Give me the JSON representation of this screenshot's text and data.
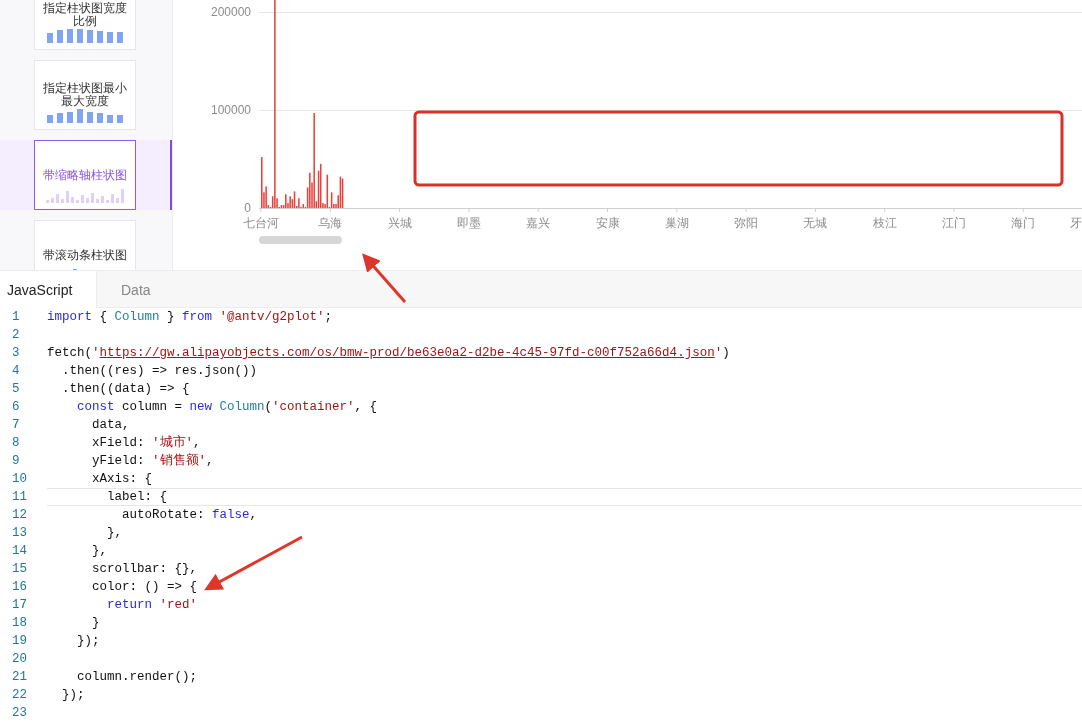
{
  "sidebar": {
    "items": [
      {
        "label": "指定柱状图宽度比例",
        "selected": false,
        "kind": "even"
      },
      {
        "label": "指定柱状图最小最大宽度",
        "selected": false,
        "kind": "peak"
      },
      {
        "label": "带缩略轴柱状图",
        "selected": true,
        "kind": "dense"
      },
      {
        "label": "带滚动条柱状图",
        "selected": false,
        "kind": "spike"
      }
    ]
  },
  "chart": {
    "y_ticks": [
      "200000",
      "100000",
      "0"
    ],
    "x_labels": [
      "七台河",
      "乌海",
      "兴城",
      "即墨",
      "嘉兴",
      "安康",
      "巢湖",
      "弥阳",
      "无城",
      "枝江",
      "江门",
      "海门",
      "牙"
    ]
  },
  "editor": {
    "tabs": [
      {
        "label": "JavaScript",
        "selected": true
      },
      {
        "label": "Data",
        "selected": false
      }
    ],
    "lines": [
      {
        "number": "1",
        "current": false,
        "tokens": [
          {
            "kind": "keyword",
            "text": "import"
          },
          {
            "kind": "plain",
            "text": " { "
          },
          {
            "kind": "type",
            "text": "Column"
          },
          {
            "kind": "plain",
            "text": " } "
          },
          {
            "kind": "keyword",
            "text": "from "
          },
          {
            "kind": "string",
            "text": "'@antv/g2plot'"
          },
          {
            "kind": "plain",
            "text": ";"
          }
        ]
      },
      {
        "number": "2",
        "current": false
      },
      {
        "number": "3",
        "current": false,
        "tokens": [
          {
            "kind": "plain",
            "text": "fetch("
          },
          {
            "kind": "string",
            "text": "'"
          },
          {
            "kind": "url",
            "text": "https://gw.alipayobjects.com/os/bmw-prod/be63e0a2-d2be-4c45-97fd-c00f752a66d4.json"
          },
          {
            "kind": "string",
            "text": "'"
          },
          {
            "kind": "plain",
            "text": ")"
          }
        ]
      },
      {
        "number": "4",
        "current": false,
        "tokens": [
          {
            "kind": "plain",
            "text": "  .then((res) => res.json())"
          }
        ]
      },
      {
        "number": "5",
        "current": false,
        "tokens": [
          {
            "kind": "plain",
            "text": "  .then((data) => {"
          }
        ]
      },
      {
        "number": "6",
        "current": false,
        "tokens": [
          {
            "kind": "keyword",
            "text": "    const"
          },
          {
            "kind": "plain",
            "text": " column = "
          },
          {
            "kind": "keyword",
            "text": "new "
          },
          {
            "kind": "type",
            "text": "Column"
          },
          {
            "kind": "plain",
            "text": "("
          },
          {
            "kind": "string",
            "text": "'container'"
          },
          {
            "kind": "plain",
            "text": ", {"
          }
        ]
      },
      {
        "number": "7",
        "current": false,
        "tokens": [
          {
            "kind": "plain",
            "text": "      data,"
          }
        ]
      },
      {
        "number": "8",
        "current": false,
        "tokens": [
          {
            "kind": "plain",
            "text": "      xField: "
          },
          {
            "kind": "string",
            "text": "'城市'"
          },
          {
            "kind": "plain",
            "text": ","
          }
        ]
      },
      {
        "number": "9",
        "current": false,
        "tokens": [
          {
            "kind": "plain",
            "text": "      yField: "
          },
          {
            "kind": "string",
            "text": "'销售额'"
          },
          {
            "kind": "plain",
            "text": ","
          }
        ]
      },
      {
        "number": "10",
        "current": false,
        "tokens": [
          {
            "kind": "plain",
            "text": "      xAxis: {"
          }
        ]
      },
      {
        "number": "11",
        "current": true,
        "tokens": [
          {
            "kind": "plain",
            "text": "        label: {"
          }
        ]
      },
      {
        "number": "12",
        "current": false,
        "tokens": [
          {
            "kind": "plain",
            "text": "          autoRotate: "
          },
          {
            "kind": "keyword",
            "text": "false"
          },
          {
            "kind": "plain",
            "text": ","
          }
        ]
      },
      {
        "number": "13",
        "current": false,
        "tokens": [
          {
            "kind": "plain",
            "text": "        },"
          }
        ]
      },
      {
        "number": "14",
        "current": false,
        "tokens": [
          {
            "kind": "plain",
            "text": "      },"
          }
        ]
      },
      {
        "number": "15",
        "current": false,
        "tokens": [
          {
            "kind": "plain",
            "text": "      scrollbar: {},"
          }
        ]
      },
      {
        "number": "16",
        "current": false,
        "tokens": [
          {
            "kind": "plain",
            "text": "      color: () => {"
          }
        ]
      },
      {
        "number": "17",
        "current": false,
        "tokens": [
          {
            "kind": "keyword",
            "text": "        return "
          },
          {
            "kind": "string",
            "text": "'red'"
          }
        ]
      },
      {
        "number": "18",
        "current": false,
        "tokens": [
          {
            "kind": "plain",
            "text": "      }"
          }
        ]
      },
      {
        "number": "19",
        "current": false,
        "tokens": [
          {
            "kind": "plain",
            "text": "    });"
          }
        ]
      },
      {
        "number": "20",
        "current": false
      },
      {
        "number": "21",
        "current": false,
        "tokens": [
          {
            "kind": "plain",
            "text": "    column.render();"
          }
        ]
      },
      {
        "number": "22",
        "current": false,
        "tokens": [
          {
            "kind": "plain",
            "text": "  });"
          }
        ]
      },
      {
        "number": "23",
        "current": false
      }
    ]
  }
}
